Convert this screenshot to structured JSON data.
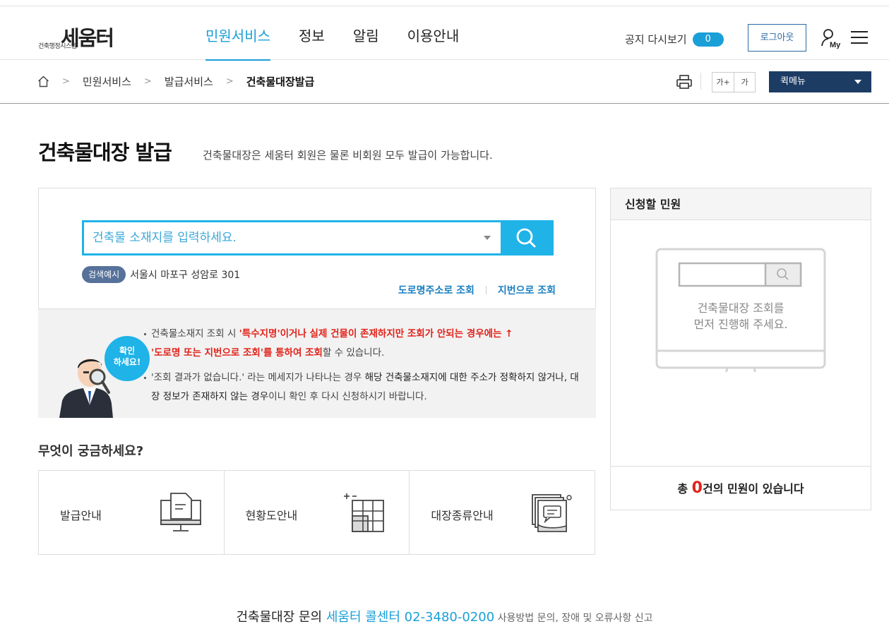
{
  "header": {
    "logo_sub": "건축행정시스템",
    "logo_main": "세움터",
    "nav": [
      "민원서비스",
      "정보",
      "알림",
      "이용안내"
    ],
    "notice_label": "공지 다시보기",
    "notice_count": "0",
    "logout_label": "로그아웃",
    "my_label": "My"
  },
  "breadcrumb": {
    "items": [
      "민원서비스",
      "발급서비스"
    ],
    "current": "건축물대장발급"
  },
  "toolbar": {
    "font_up": "가+",
    "font_down": "가",
    "quick_menu": "퀵메뉴"
  },
  "page": {
    "title": "건축물대장 발급",
    "description": "건축물대장은 세움터 회원은 물론 비회원 모두 발급이 가능합니다."
  },
  "search": {
    "placeholder": "건축물 소재지를 입력하세요.",
    "example_tag": "검색예시",
    "example_text": "서울시 마포구 성암로 301",
    "link_road": "도로명주소로 조회",
    "link_lot": "지번으로 조회"
  },
  "info": {
    "bubble_line1": "확인",
    "bubble_line2": "하세요!",
    "p1_a": "건축물소재지 조회 시 ",
    "p1_b": "'특수지명'이거나 실제 건물이 존재하지만 조회가 안되는 경우에는 ↑",
    "p1_c": "'도로명 또는 지번으로 조회'를 통하여 조회",
    "p1_d": "할 수 있습니다.",
    "p2_a": "'조회 결과가 없습니다.' 라는 메세지가 나타나는 경우 ",
    "p2_b": "해당 건축물소재지에 대한 주소가 정확하지 않거나, 대장 정보가 존재하지 않는 경우",
    "p2_c": "이니 확인 후 다시 신청하시기 바랍니다."
  },
  "faq": {
    "title": "무엇이 궁금하세요?",
    "items": [
      "발급안내",
      "현황도안내",
      "대장종류안내"
    ]
  },
  "apply": {
    "title": "신청할 민원",
    "empty_line1": "건축물대장 조회를",
    "empty_line2": "먼저 진행해 주세요.",
    "count_prefix": "총 ",
    "count": "0",
    "count_suffix": "건의 민원이 있습니다"
  },
  "footer": {
    "prefix": "건축물대장 문의 ",
    "center": "세움터 콜센터 02-3480-0200",
    "suffix": " 사용방법 문의, 장애 및 오류사항 신고"
  },
  "colors": {
    "accent": "#1a9fd8",
    "search_border": "#1fb3e8",
    "quick_menu_bg": "#1c3c64",
    "highlight_red": "#e2231a"
  }
}
